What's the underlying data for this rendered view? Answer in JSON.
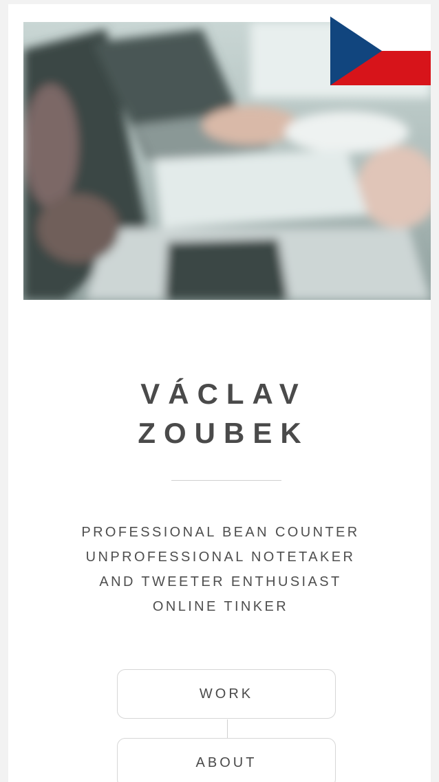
{
  "profile": {
    "name_line1": "VÁCLAV",
    "name_line2": "ZOUBEK",
    "tagline": [
      "PROFESSIONAL BEAN COUNTER",
      "UNPROFESSIONAL NOTETAKER",
      "AND TWEETER ENTHUSIAST",
      "ONLINE TINKER"
    ]
  },
  "nav": {
    "work_label": "WORK",
    "about_label": "ABOUT"
  },
  "language": {
    "flag_icon": "czech-flag-icon",
    "colors": {
      "white": "#ffffff",
      "red": "#d7141a",
      "blue": "#11457e"
    }
  },
  "hero": {
    "image": "blurred-laptops-desk-photo"
  }
}
